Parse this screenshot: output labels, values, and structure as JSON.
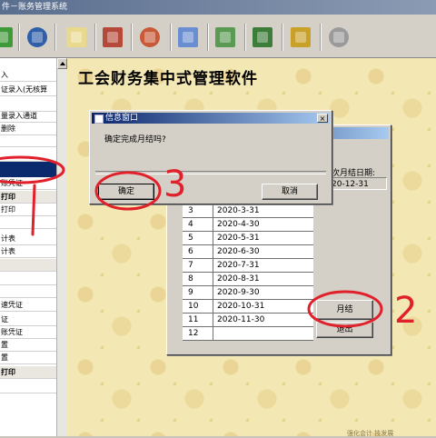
{
  "window": {
    "title": "件－账务管理系统"
  },
  "toolbar": {
    "icons": [
      "book-icon",
      "globe-icon",
      "note-icon",
      "paint-icon",
      "disk-icon",
      "box-icon",
      "printer-icon",
      "door-exit-icon",
      "person-icon",
      "clock-icon"
    ]
  },
  "sidebar": {
    "items": [
      {
        "label": "入",
        "group": false
      },
      {
        "label": "证录入(无核算",
        "group": false
      },
      {
        "label": "",
        "group": false
      },
      {
        "label": "量录入通道",
        "group": false
      },
      {
        "label": "删除",
        "group": false
      },
      {
        "label": "",
        "group": false
      },
      {
        "label": "",
        "group": false
      },
      {
        "label": "账凭证",
        "group": false
      },
      {
        "label": "打印",
        "group": true
      },
      {
        "label": "打印",
        "group": false
      },
      {
        "label": "",
        "group": false
      },
      {
        "label": "计表",
        "group": false
      },
      {
        "label": "计表",
        "group": false
      },
      {
        "label": "",
        "group": true
      },
      {
        "label": "",
        "group": false
      },
      {
        "label": "",
        "group": false
      },
      {
        "label": "速凭证",
        "group": false
      },
      {
        "label": "证",
        "group": false
      },
      {
        "label": "账凭证",
        "group": false
      },
      {
        "label": "置",
        "group": false
      },
      {
        "label": "置",
        "group": false
      },
      {
        "label": "打印",
        "group": true
      },
      {
        "label": "",
        "group": false
      }
    ]
  },
  "main": {
    "title": "工会财务集中式管理软件"
  },
  "month_end_window": {
    "last_close_label": "次月结日期:",
    "last_close_value": "20-12-31",
    "rows": [
      {
        "month": "3",
        "date": "2020-3-31"
      },
      {
        "month": "4",
        "date": "2020-4-30"
      },
      {
        "month": "5",
        "date": "2020-5-31"
      },
      {
        "month": "6",
        "date": "2020-6-30"
      },
      {
        "month": "7",
        "date": "2020-7-31"
      },
      {
        "month": "8",
        "date": "2020-8-31"
      },
      {
        "month": "9",
        "date": "2020-9-30"
      },
      {
        "month": "10",
        "date": "2020-10-31"
      },
      {
        "month": "11",
        "date": "2020-11-30"
      },
      {
        "month": "12",
        "date": ""
      }
    ],
    "close_button": "月结",
    "exit_button": "退出"
  },
  "message_box": {
    "title": "信息窗口",
    "message": "确定完成月结吗?",
    "confirm_button": "确定",
    "cancel_button": "取消",
    "close_glyph": "×"
  },
  "annotations": {
    "step_2": "2",
    "step_3": "3",
    "marker_color": "#e0202a"
  },
  "footer": {
    "text": "强化会计 技发展"
  }
}
